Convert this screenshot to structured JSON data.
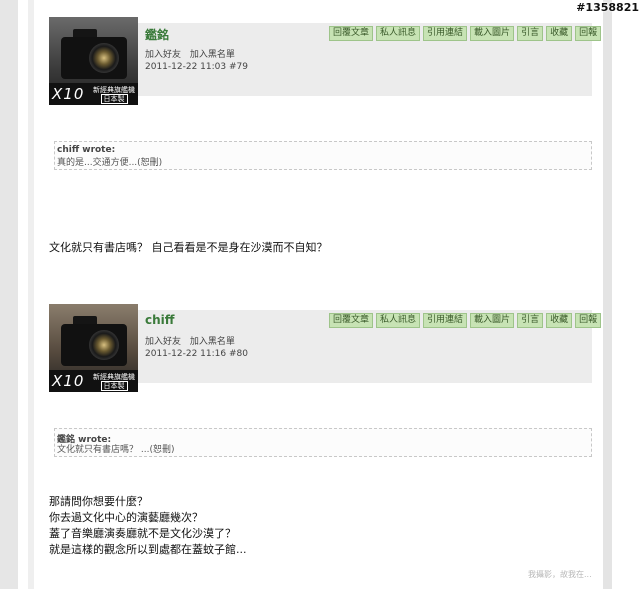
{
  "watermark": "#1358821",
  "buttons": [
    "回覆文章",
    "私人訊息",
    "引用連結",
    "載入圖片",
    "引言",
    "收藏",
    "回報"
  ],
  "links": {
    "add_friend": "加入好友",
    "add_block": "加入黑名單"
  },
  "avatar_caption": {
    "model": "X10",
    "line1": "新經典旗艦機",
    "line2": "日本製"
  },
  "posts": [
    {
      "username": "鑑銘",
      "meta": "2011-12-22 11:03 #79",
      "quote_author": "chiff wrote:",
      "quote_text": "真的是...交通方便...(恕刪)",
      "body": [
        "文化就只有書店嗎？ 自己看看是不是身在沙漠而不自知？"
      ]
    },
    {
      "username": "chiff",
      "meta": "2011-12-22 11:16 #80",
      "quote_author": "鑑銘 wrote:",
      "quote_text": "文化就只有書店嗎？ ...(恕刪)",
      "body": [
        "那請問你想要什麼？",
        "你去過文化中心的演藝廳幾次？",
        "蓋了音樂廳演奏廳就不是文化沙漠了？",
        "就是這樣的觀念所以到處都在蓋蚊子館..."
      ]
    }
  ],
  "signature": "我攝影，故我在..."
}
